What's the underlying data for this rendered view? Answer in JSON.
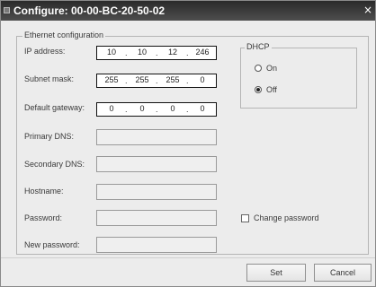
{
  "window": {
    "title": "Configure: 00-00-BC-20-50-02",
    "close_label": "×"
  },
  "ethernet": {
    "group_label": "Ethernet configuration",
    "ip_label": "IP address:",
    "ip": [
      "10",
      "10",
      "12",
      "246"
    ],
    "subnet_label": "Subnet mask:",
    "subnet": [
      "255",
      "255",
      "255",
      "0"
    ],
    "gateway_label": "Default gateway:",
    "gateway": [
      "0",
      "0",
      "0",
      "0"
    ],
    "primary_dns_label": "Primary DNS:",
    "primary_dns_value": "",
    "secondary_dns_label": "Secondary DNS:",
    "secondary_dns_value": "",
    "hostname_label": "Hostname:",
    "hostname_value": "",
    "password_label": "Password:",
    "password_value": "",
    "new_password_label": "New password:",
    "new_password_value": ""
  },
  "dhcp": {
    "group_label": "DHCP",
    "on_label": "On",
    "off_label": "Off",
    "selected": "Off"
  },
  "change_password": {
    "label": "Change password",
    "checked": false
  },
  "buttons": {
    "set_label": "Set",
    "cancel_label": "Cancel"
  }
}
